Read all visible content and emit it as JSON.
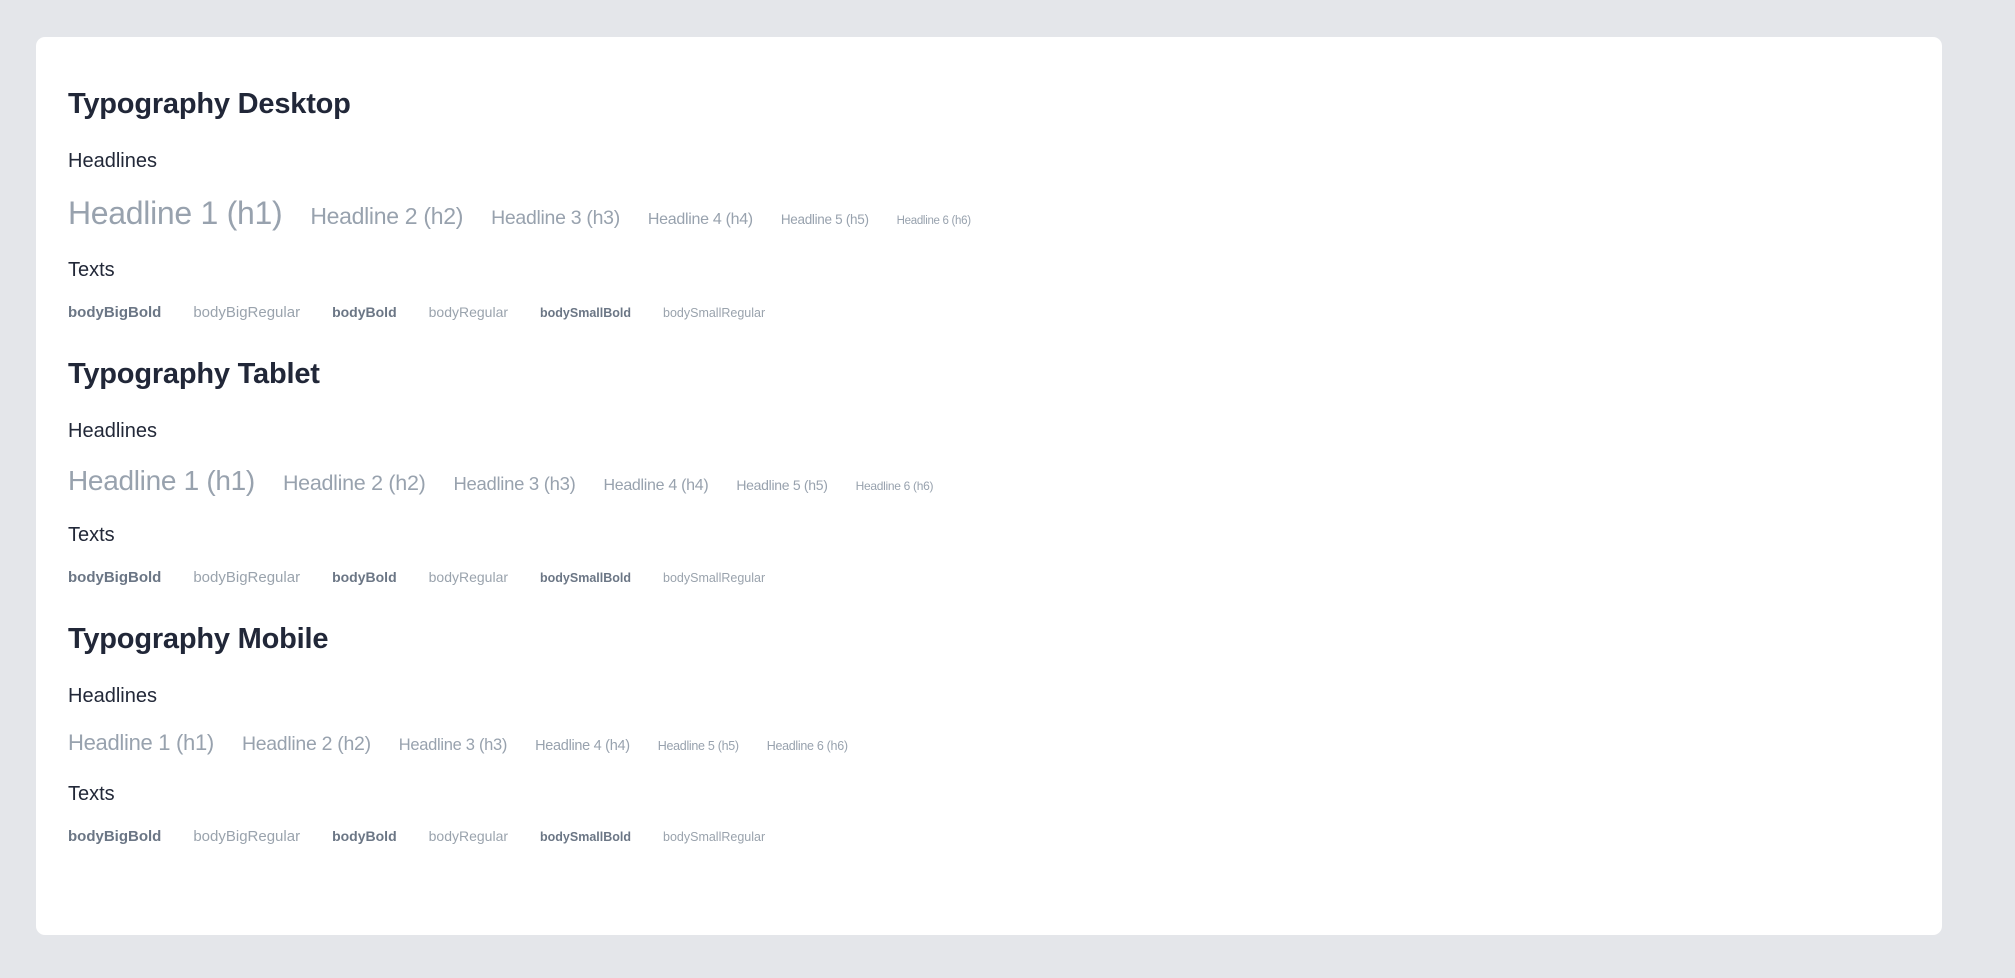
{
  "page": {
    "background_color": "#e4e6ea",
    "card_background_color": "#ffffff"
  },
  "colors": {
    "section_title": "#212738",
    "sub_title": "#222838",
    "headline_sample": "#98a2ae",
    "body_bold_sample": "#6b7685",
    "body_regular_sample": "#9aa3ad"
  },
  "labels": {
    "headlines": "Headlines",
    "texts": "Texts"
  },
  "headline_samples": [
    "Headline 1 (h1)",
    "Headline 2 (h2)",
    "Headline 3 (h3)",
    "Headline 4 (h4)",
    "Headline 5 (h5)",
    "Headline 6 (h6)"
  ],
  "text_samples": [
    "bodyBigBold",
    "bodyBigRegular",
    "bodyBold",
    "bodyRegular",
    "bodySmallBold",
    "bodySmallRegular"
  ],
  "sections": [
    {
      "key": "desktop",
      "title": "Typography Desktop",
      "headlines_label": "Headlines",
      "texts_label": "Texts",
      "headlines": [
        "Headline 1 (h1)",
        "Headline 2 (h2)",
        "Headline 3 (h3)",
        "Headline 4 (h4)",
        "Headline 5 (h5)",
        "Headline 6 (h6)"
      ],
      "texts": [
        "bodyBigBold",
        "bodyBigRegular",
        "bodyBold",
        "bodyRegular",
        "bodySmallBold",
        "bodySmallRegular"
      ]
    },
    {
      "key": "tablet",
      "title": "Typography Tablet",
      "headlines_label": "Headlines",
      "texts_label": "Texts",
      "headlines": [
        "Headline 1 (h1)",
        "Headline 2 (h2)",
        "Headline 3 (h3)",
        "Headline 4 (h4)",
        "Headline 5 (h5)",
        "Headline 6 (h6)"
      ],
      "texts": [
        "bodyBigBold",
        "bodyBigRegular",
        "bodyBold",
        "bodyRegular",
        "bodySmallBold",
        "bodySmallRegular"
      ]
    },
    {
      "key": "mobile",
      "title": "Typography Mobile",
      "headlines_label": "Headlines",
      "texts_label": "Texts",
      "headlines": [
        "Headline 1 (h1)",
        "Headline 2 (h2)",
        "Headline 3 (h3)",
        "Headline 4 (h4)",
        "Headline 5 (h5)",
        "Headline 6 (h6)"
      ],
      "texts": [
        "bodyBigBold",
        "bodyBigRegular",
        "bodyBold",
        "bodyRegular",
        "bodySmallBold",
        "bodySmallRegular"
      ]
    }
  ]
}
